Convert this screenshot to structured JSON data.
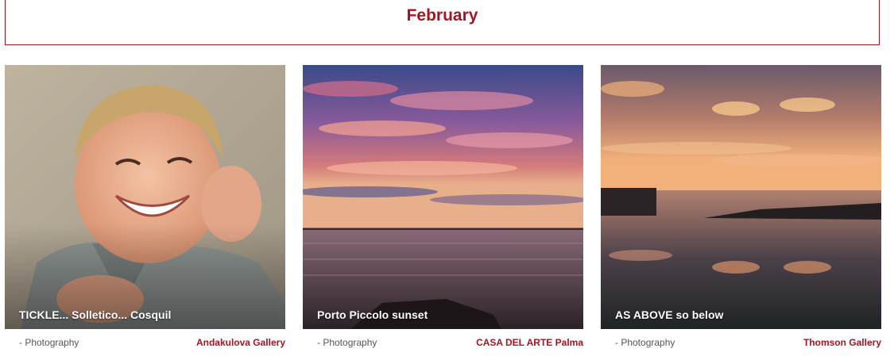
{
  "header": {
    "title": "February"
  },
  "cards": [
    {
      "title": "TICKLE... Solletico... Cosquil",
      "category": "- Photography",
      "gallery": "Andakulova Gallery",
      "image": "smiling-child-photo"
    },
    {
      "title": "Porto Piccolo sunset",
      "category": "- Photography",
      "gallery": "CASA DEL ARTE Palma",
      "image": "sunset-sea-photo"
    },
    {
      "title": "AS ABOVE so below",
      "category": "- Photography",
      "gallery": "Thomson Gallery",
      "image": "sunset-reflection-photo"
    }
  ],
  "colors": {
    "accent": "#a31621"
  }
}
